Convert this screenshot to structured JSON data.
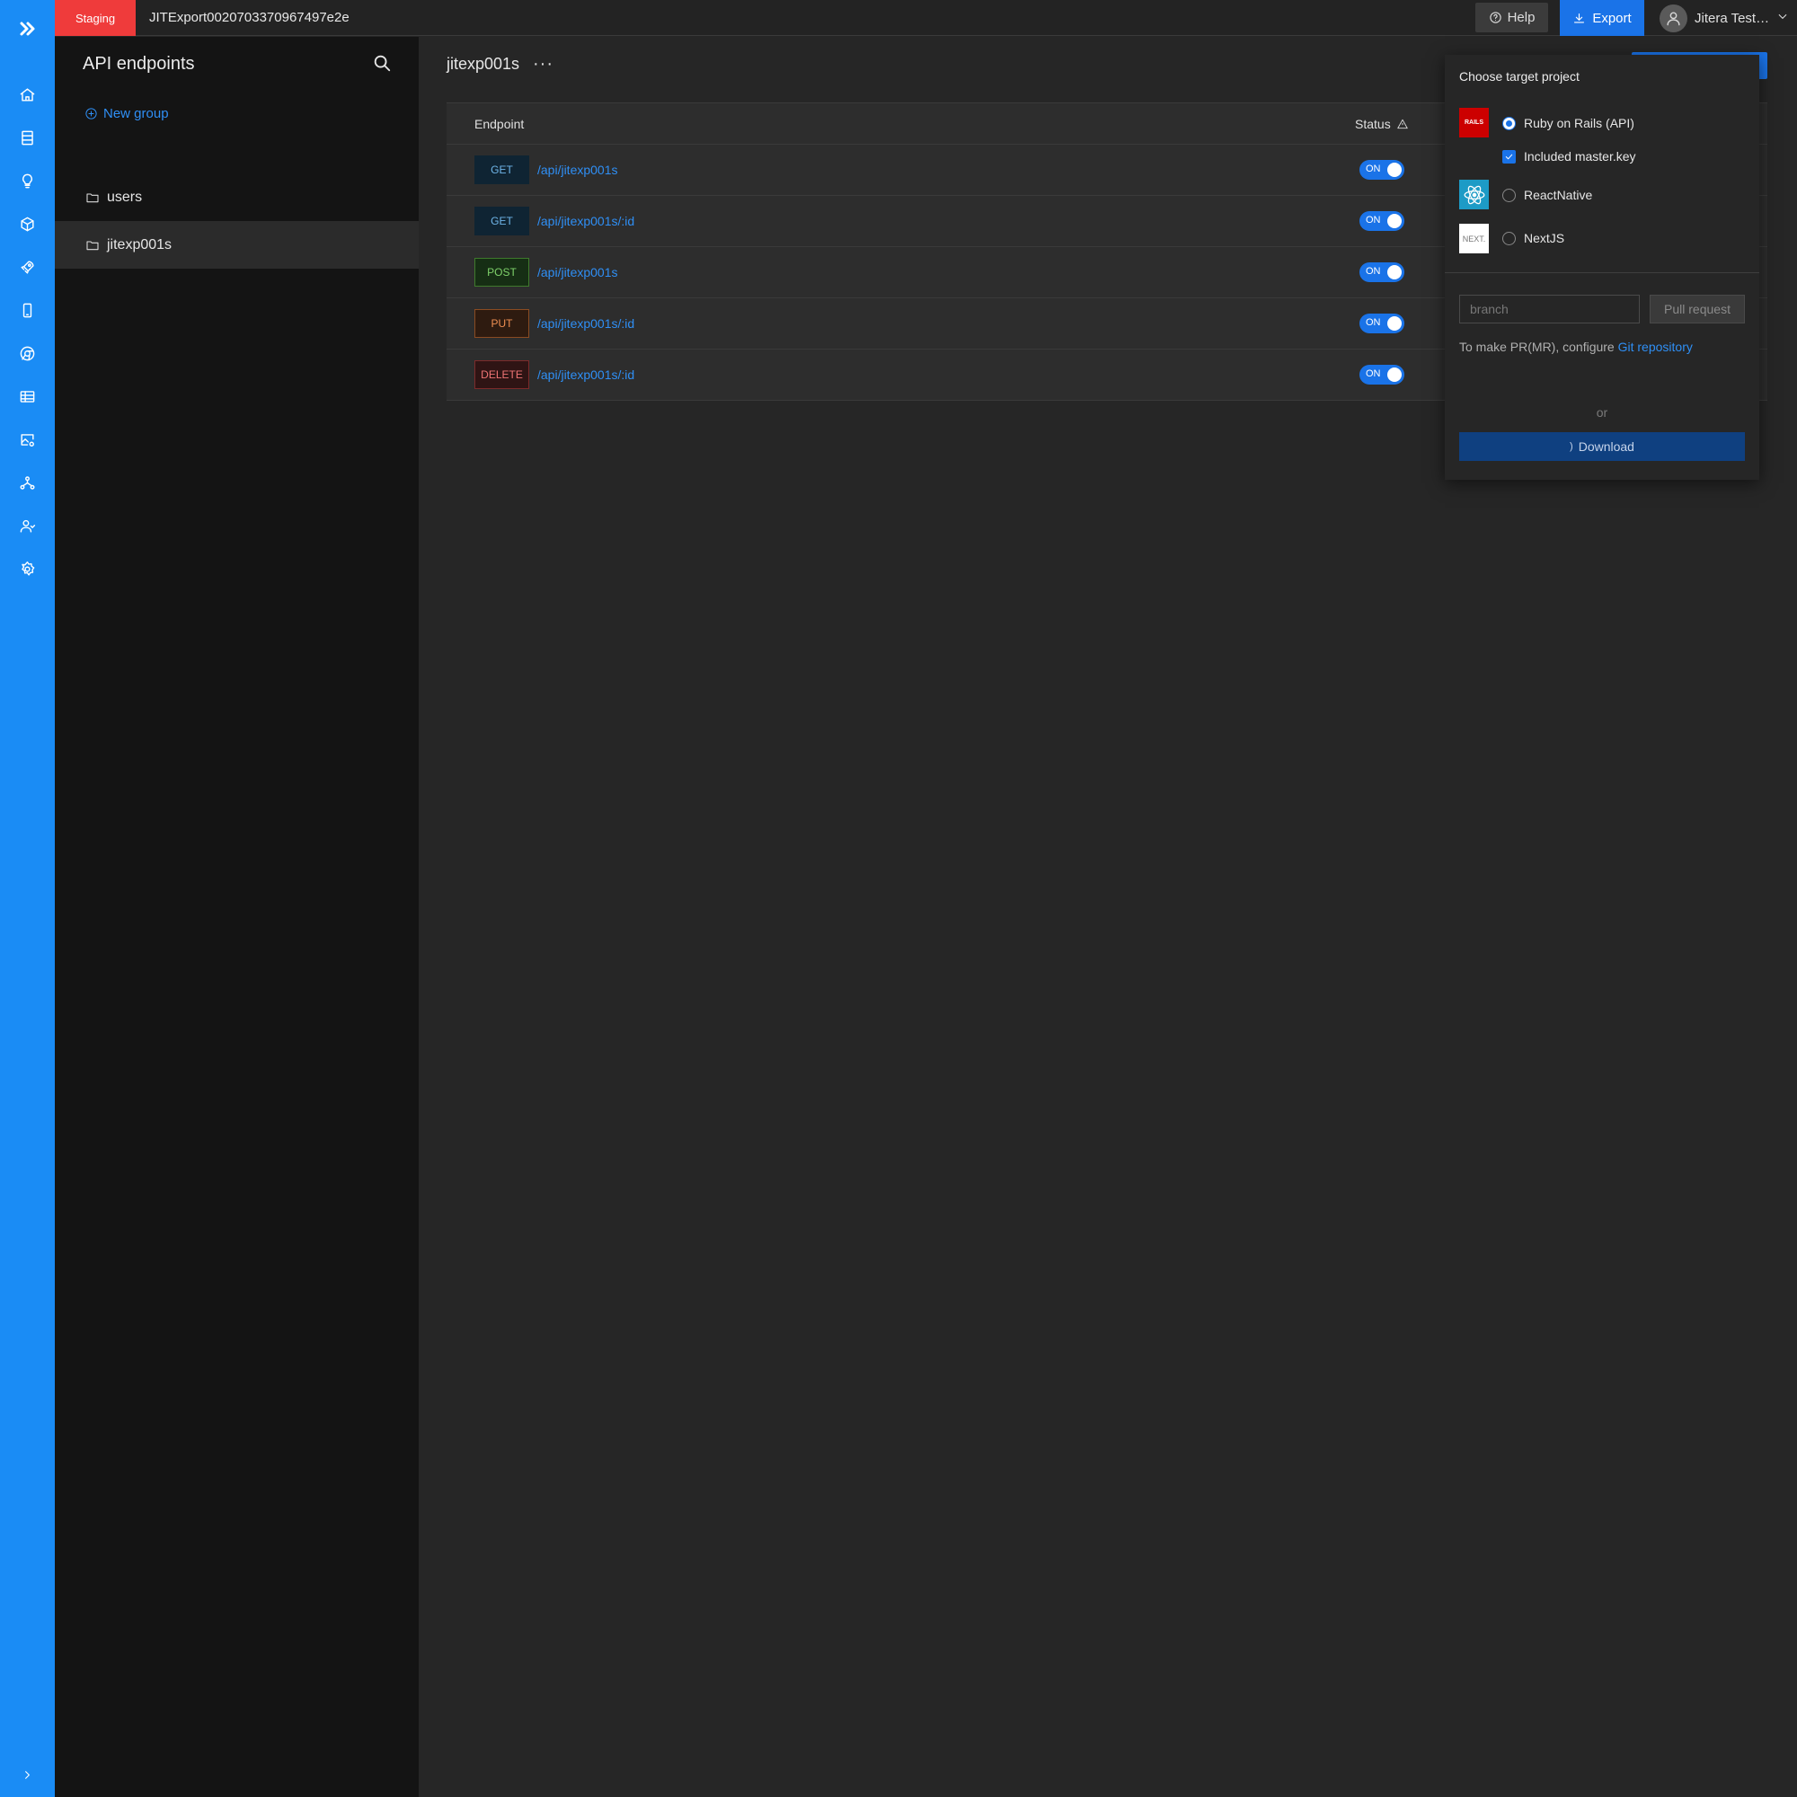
{
  "rail": {
    "items": [
      "home-icon",
      "database-icon",
      "lightbulb-icon",
      "cube-icon",
      "rocket-icon",
      "mobile-icon",
      "chrome-icon",
      "table-icon",
      "image-settings-icon",
      "network-icon",
      "users-icon",
      "gear-icon"
    ]
  },
  "topbar": {
    "env_badge": "Staging",
    "project_name": "JITExport0020703370967497e2e",
    "help_label": "Help",
    "export_label": "Export",
    "user_name": "Jitera Test…"
  },
  "sidebar": {
    "title": "API endpoints",
    "new_group_label": "New group",
    "groups": [
      {
        "name": "users"
      },
      {
        "name": "jitexp001s"
      }
    ]
  },
  "main": {
    "title": "jitexp001s",
    "more_label": "···",
    "table": {
      "headers": {
        "endpoint": "Endpoint",
        "status": "Status"
      },
      "rows": [
        {
          "method": "GET",
          "path": "/api/jitexp001s",
          "status": "ON"
        },
        {
          "method": "GET",
          "path": "/api/jitexp001s/:id",
          "status": "ON"
        },
        {
          "method": "POST",
          "path": "/api/jitexp001s",
          "status": "ON"
        },
        {
          "method": "PUT",
          "path": "/api/jitexp001s/:id",
          "status": "ON"
        },
        {
          "method": "DELETE",
          "path": "/api/jitexp001s/:id",
          "status": "ON"
        }
      ]
    }
  },
  "export_popup": {
    "title": "Choose target project",
    "targets": [
      {
        "name": "Ruby on Rails (API)",
        "logo_text": "RAILS",
        "selected": true
      },
      {
        "name": "ReactNative",
        "logo_text": "",
        "selected": false
      },
      {
        "name": "NextJS",
        "logo_text": "NEXT.",
        "selected": false
      }
    ],
    "master_key_label": "Included master.key",
    "master_key_checked": true,
    "branch_placeholder": "branch",
    "pull_request_label": "Pull request",
    "pr_note": "To make PR(MR), configure",
    "git_link_label": "Git repository",
    "or_label": "or",
    "download_label": "Download"
  },
  "colors": {
    "rail": "#1a8cf5",
    "accent": "#1a73e8",
    "staging": "#ef3b3b",
    "link": "#2f8ff5"
  }
}
